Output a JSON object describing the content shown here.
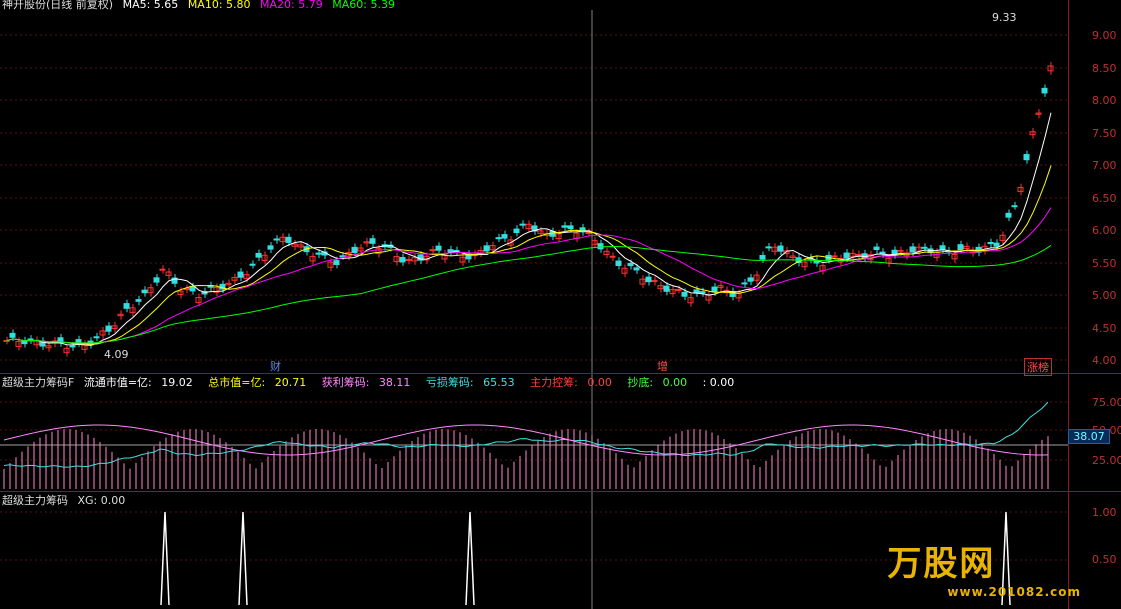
{
  "main_panel": {
    "title": "神开股份(日线 前复权)",
    "ma_labels": [
      {
        "text": "MA5: 5.65",
        "color": "#ffffff"
      },
      {
        "text": "MA10: 5.80",
        "color": "#ffff00"
      },
      {
        "text": "MA20: 5.79",
        "color": "#ff00ff"
      },
      {
        "text": "MA60: 5.39",
        "color": "#00ff00"
      }
    ],
    "price_axis": [
      "9.00",
      "8.50",
      "8.00",
      "7.50",
      "7.00",
      "6.50",
      "6.00",
      "5.50",
      "5.00",
      "4.50",
      "4.00"
    ],
    "high_label": "9.33",
    "low_label": "4.09",
    "badges": [
      {
        "text": "财",
        "color": "#3060ff"
      },
      {
        "text": "增",
        "color": "#c03030"
      },
      {
        "text": "涨榜",
        "color": "#c03030"
      }
    ]
  },
  "indicator1": {
    "name": "超级主力筹码F",
    "items": [
      {
        "label": "流通市值=亿:",
        "value": "19.02",
        "color": "#ffffff"
      },
      {
        "label": "总市值=亿:",
        "value": "20.71",
        "color": "#ffff00"
      },
      {
        "label": "获利筹码:",
        "value": "38.11",
        "color": "#ff88ff"
      },
      {
        "label": "亏损筹码:",
        "value": "65.53",
        "color": "#40e0e0"
      },
      {
        "label": "主力控筹:",
        "value": "0.00",
        "color": "#ff4040"
      },
      {
        "label": "抄底:",
        "value": "0.00",
        "color": "#40ff40"
      },
      {
        "label": "",
        "value": ": 0.00",
        "color": "#ffffff"
      }
    ],
    "axis": [
      "75.00",
      "50.00",
      "25.00"
    ],
    "current_value": "38.07"
  },
  "indicator2": {
    "name": "超级主力筹码",
    "value_label": "XG: 0.00",
    "axis": [
      "1.00",
      "0.50"
    ]
  },
  "watermark": {
    "brand": "万股网",
    "url": "www.201082.com"
  },
  "colors": {
    "up": "#ff3030",
    "down": "#30e0e0",
    "ma5": "#ffffff",
    "ma10": "#ffff00",
    "ma20": "#ff00ff",
    "ma60": "#00ff00"
  }
}
